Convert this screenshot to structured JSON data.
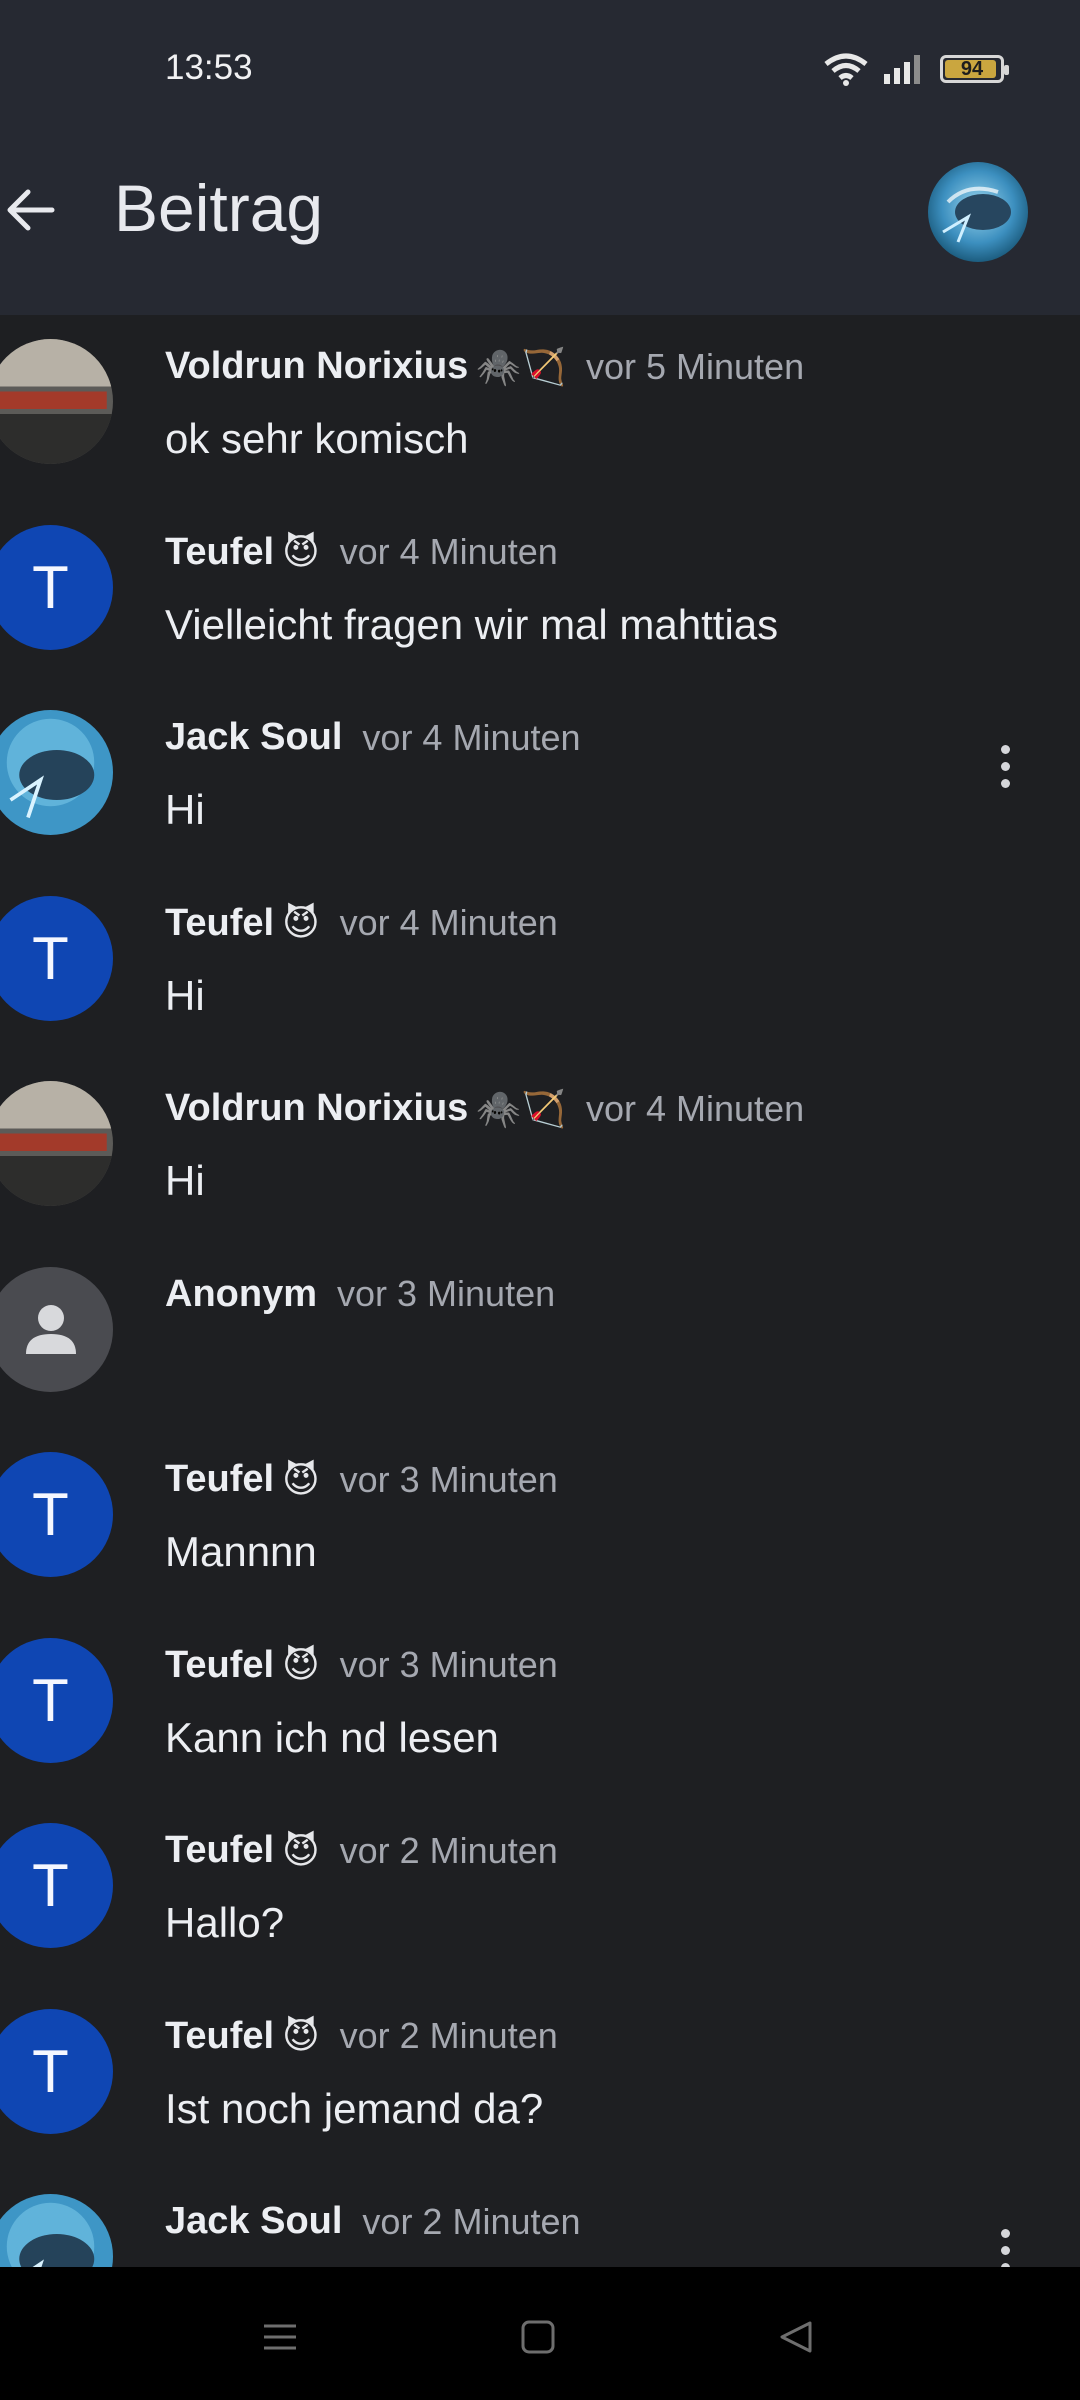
{
  "status": {
    "time": "13:53",
    "battery": "94",
    "battery_level": 0.94
  },
  "header": {
    "title": "Beitrag",
    "back_icon": "arrow-left-icon"
  },
  "comments": [
    {
      "author": "Voldrun Norixius",
      "badges": "🕷️🏹",
      "time": "vor 5 Minuten",
      "text": "ok sehr komisch",
      "avatar": "image",
      "has_menu": false
    },
    {
      "author": "Teufel",
      "badges": "😈",
      "time": "vor 4 Minuten",
      "text": "Vielleicht fragen wir mal mahttias",
      "avatar_letter": "T",
      "has_menu": false
    },
    {
      "author": "Jack Soul",
      "badges": "",
      "time": "vor 4 Minuten",
      "text": "Hi",
      "avatar": "image",
      "has_menu": true
    },
    {
      "author": "Teufel",
      "badges": "😈",
      "time": "vor 4 Minuten",
      "text": "Hi",
      "avatar_letter": "T",
      "has_menu": false
    },
    {
      "author": "Voldrun Norixius",
      "badges": "🕷️🏹",
      "time": "vor 4 Minuten",
      "text": "Hi",
      "avatar": "image",
      "has_menu": false
    },
    {
      "author": "Anonym",
      "badges": "",
      "time": "vor 3 Minuten",
      "text": "",
      "avatar": "anonymous",
      "has_menu": false
    },
    {
      "author": "Teufel",
      "badges": "😈",
      "time": "vor 3 Minuten",
      "text": "Mannnn",
      "avatar_letter": "T",
      "has_menu": false
    },
    {
      "author": "Teufel",
      "badges": "😈",
      "time": "vor 3 Minuten",
      "text": "Kann ich nd lesen",
      "avatar_letter": "T",
      "has_menu": false
    },
    {
      "author": "Teufel",
      "badges": "😈",
      "time": "vor 2 Minuten",
      "text": "Hallo?",
      "avatar_letter": "T",
      "has_menu": false
    },
    {
      "author": "Teufel",
      "badges": "😈",
      "time": "vor 2 Minuten",
      "text": "Ist noch jemand da?",
      "avatar_letter": "T",
      "has_menu": false
    },
    {
      "author": "Jack Soul",
      "badges": "",
      "time": "vor 2 Minuten",
      "text": "",
      "avatar": "image",
      "has_menu": true
    }
  ],
  "nav": {
    "menu_icon": "menu-icon",
    "home_icon": "home-square-icon",
    "back_icon": "triangle-back-icon"
  },
  "colors": {
    "background": "#1e1f22",
    "bar": "#262932",
    "avatar_blue": "#0f46b3",
    "muted": "#a5a8b0"
  }
}
